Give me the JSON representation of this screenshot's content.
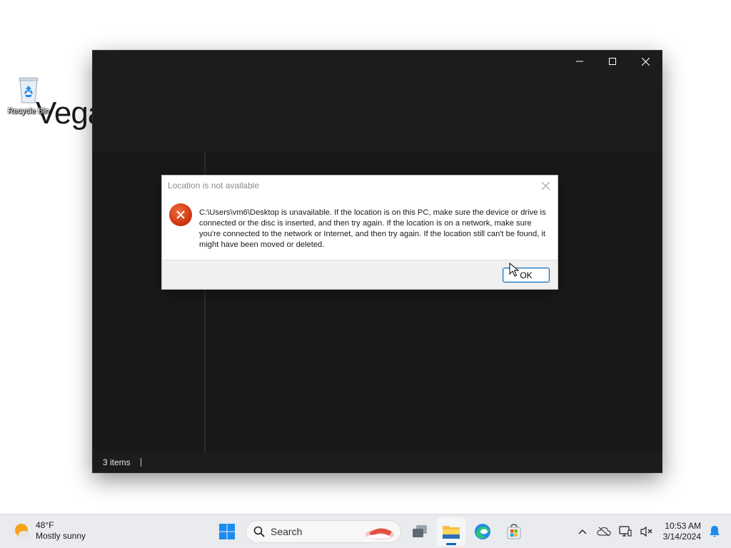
{
  "desktop": {
    "big_text": "Vega",
    "recycle_bin_label": "Recycle Bin"
  },
  "explorer": {
    "status_items": "3 items"
  },
  "dialog": {
    "title": "Location is not available",
    "message": "C:\\Users\\vm6\\Desktop is unavailable. If the location is on this PC, make sure the device or drive is connected or the disc is inserted, and then try again. If the location is on a network, make sure you're connected to the network or Internet, and then try again. If the location still can't be found, it might have been moved or deleted.",
    "ok_label": "OK",
    "icon": "error-icon"
  },
  "taskbar": {
    "weather": {
      "temp": "48°F",
      "condition": "Mostly sunny"
    },
    "search_label": "Search",
    "pinned": [
      "start",
      "search",
      "task-view",
      "file-explorer",
      "edge",
      "microsoft-store"
    ],
    "active_app": "file-explorer",
    "tray": [
      "show-hidden-icons",
      "onedrive",
      "network",
      "volume-muted"
    ],
    "clock": {
      "time": "10:53 AM",
      "date": "3/14/2024"
    }
  },
  "colors": {
    "accent": "#0067c0",
    "window_bg": "#1c1c1c",
    "error_red": "#d9441c",
    "taskbar_bg": "#e9ebee"
  }
}
